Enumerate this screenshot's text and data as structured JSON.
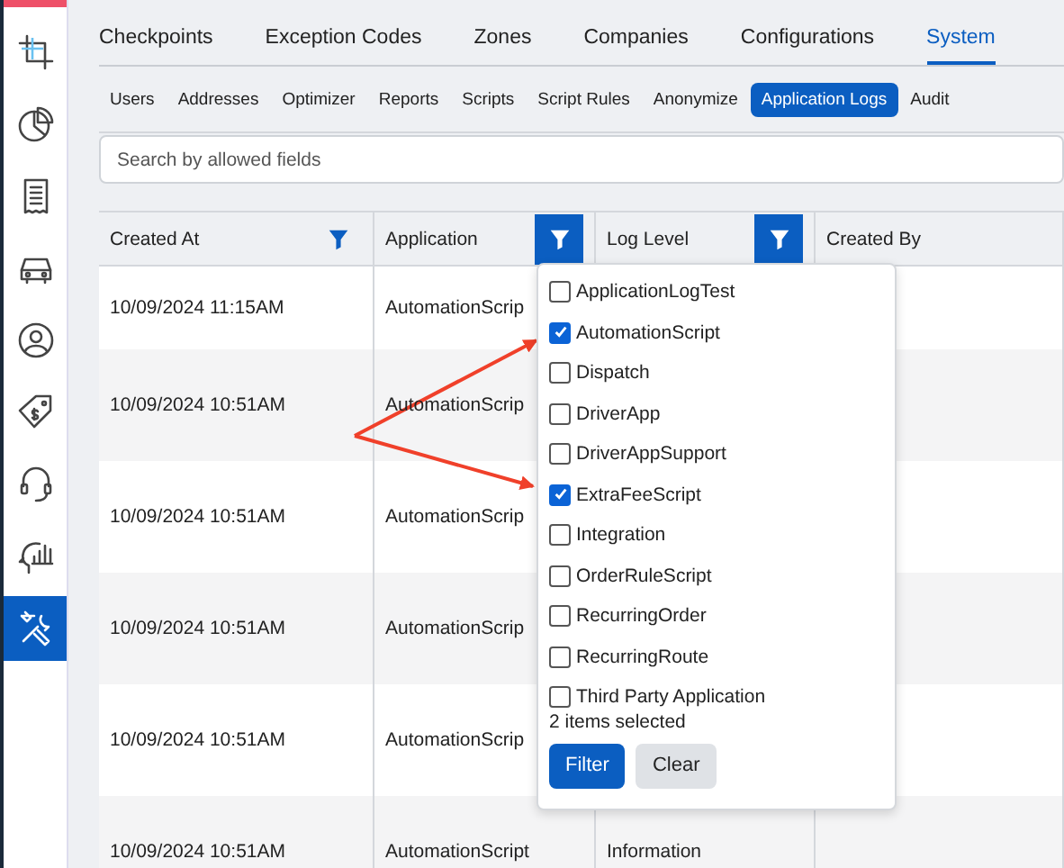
{
  "sidebar": {
    "items": [
      {
        "selected": false
      },
      {
        "selected": false
      },
      {
        "selected": false
      },
      {
        "selected": false
      },
      {
        "selected": false
      },
      {
        "selected": false
      },
      {
        "selected": false
      },
      {
        "selected": false
      },
      {
        "selected": true
      }
    ]
  },
  "tabs": [
    {
      "label": "Checkpoints",
      "selected": false
    },
    {
      "label": "Exception Codes",
      "selected": false
    },
    {
      "label": "Zones",
      "selected": false
    },
    {
      "label": "Companies",
      "selected": false
    },
    {
      "label": "Configurations",
      "selected": false
    },
    {
      "label": "System",
      "selected": true
    }
  ],
  "subtabs": [
    {
      "label": "Users",
      "selected": false
    },
    {
      "label": "Addresses",
      "selected": false
    },
    {
      "label": "Optimizer",
      "selected": false
    },
    {
      "label": "Reports",
      "selected": false
    },
    {
      "label": "Scripts",
      "selected": false
    },
    {
      "label": "Script Rules",
      "selected": false
    },
    {
      "label": "Anonymize",
      "selected": false
    },
    {
      "label": "Application Logs",
      "selected": true
    },
    {
      "label": "Audit",
      "selected": false
    }
  ],
  "search": {
    "placeholder": "Search by allowed fields"
  },
  "table": {
    "columns": [
      {
        "label": "Created At",
        "filter_active": false
      },
      {
        "label": "Application",
        "filter_active": true
      },
      {
        "label": "Log Level",
        "filter_active": true
      },
      {
        "label": "Created By"
      }
    ],
    "rows": [
      {
        "cells": [
          "10/09/2024 11:15AM",
          "AutomationScrip"
        ]
      },
      {
        "cells": [
          "10/09/2024 10:51AM",
          "AutomationScrip"
        ]
      },
      {
        "cells": [
          "10/09/2024 10:51AM",
          "AutomationScrip"
        ]
      },
      {
        "cells": [
          "10/09/2024 10:51AM",
          "AutomationScrip"
        ]
      },
      {
        "cells": [
          "10/09/2024 10:51AM",
          "AutomationScrip"
        ]
      },
      {
        "cells": [
          "10/09/2024 10:51AM",
          "AutomationScript",
          "Information"
        ]
      }
    ]
  },
  "filter_popup": {
    "options": [
      {
        "label": "ApplicationLogTest",
        "checked": false
      },
      {
        "label": "AutomationScript",
        "checked": true
      },
      {
        "label": "Dispatch",
        "checked": false
      },
      {
        "label": "DriverApp",
        "checked": false
      },
      {
        "label": "DriverAppSupport",
        "checked": false
      },
      {
        "label": "ExtraFeeScript",
        "checked": true
      },
      {
        "label": "Integration",
        "checked": false
      },
      {
        "label": "OrderRuleScript",
        "checked": false
      },
      {
        "label": "RecurringOrder",
        "checked": false
      },
      {
        "label": "RecurringRoute",
        "checked": false
      },
      {
        "label": "Third Party Application",
        "checked": false
      }
    ],
    "summary": "2 items selected",
    "buttons": [
      {
        "label": "Filter",
        "kind": "primary"
      },
      {
        "label": "Clear",
        "kind": "secondary"
      }
    ]
  }
}
